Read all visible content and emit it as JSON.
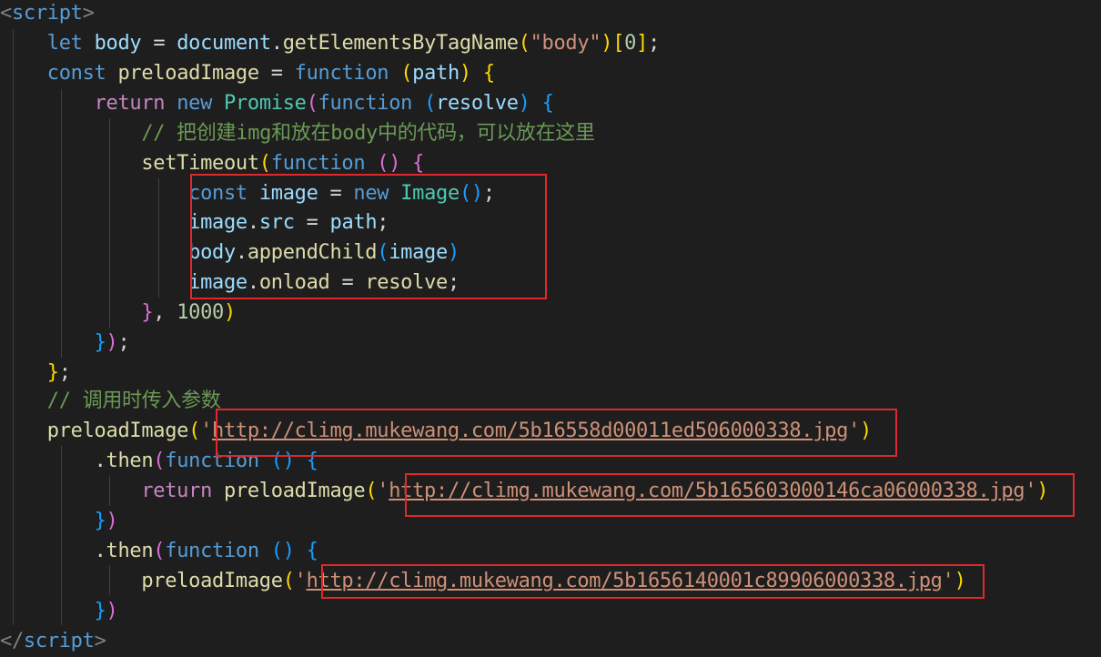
{
  "code": {
    "open_tag": "script",
    "close_tag": "script",
    "kw_let": "let",
    "kw_const": "const",
    "kw_function": "function",
    "kw_return": "return",
    "kw_new": "new",
    "var_body": "body",
    "var_document": "document",
    "fn_getElementsByTagName": "getElementsByTagName",
    "str_body": "\"body\"",
    "num_zero": "0",
    "fn_preloadImage": "preloadImage",
    "param_path": "path",
    "cls_promise": "Promise",
    "param_resolve": "resolve",
    "comment_1": "// 把创建img和放在body中的代码，可以放在这里",
    "fn_setTimeout": "setTimeout",
    "var_image": "image",
    "cls_image": "Image",
    "prop_src": "src",
    "fn_appendChild": "appendChild",
    "prop_onload": "onload",
    "num_delay": "1000",
    "comment_2": "// 调用时传入参数",
    "fn_then": "then",
    "url_1": "http://climg.mukewang.com/5b16558d00011ed506000338.jpg",
    "url_2": "http://climg.mukewang.com/5b165603000146ca06000338.jpg",
    "url_3": "http://climg.mukewang.com/5b1656140001c89906000338.jpg"
  },
  "colors": {
    "background": "#1e1e1e",
    "highlight_box": "#e0282c",
    "keyword": "#569cd6",
    "control": "#c586c0",
    "variable": "#9cdcfe",
    "function": "#dcdcaa",
    "class": "#4ec9b0",
    "string": "#ce9178",
    "number": "#b5cea8",
    "comment": "#6a9955"
  }
}
